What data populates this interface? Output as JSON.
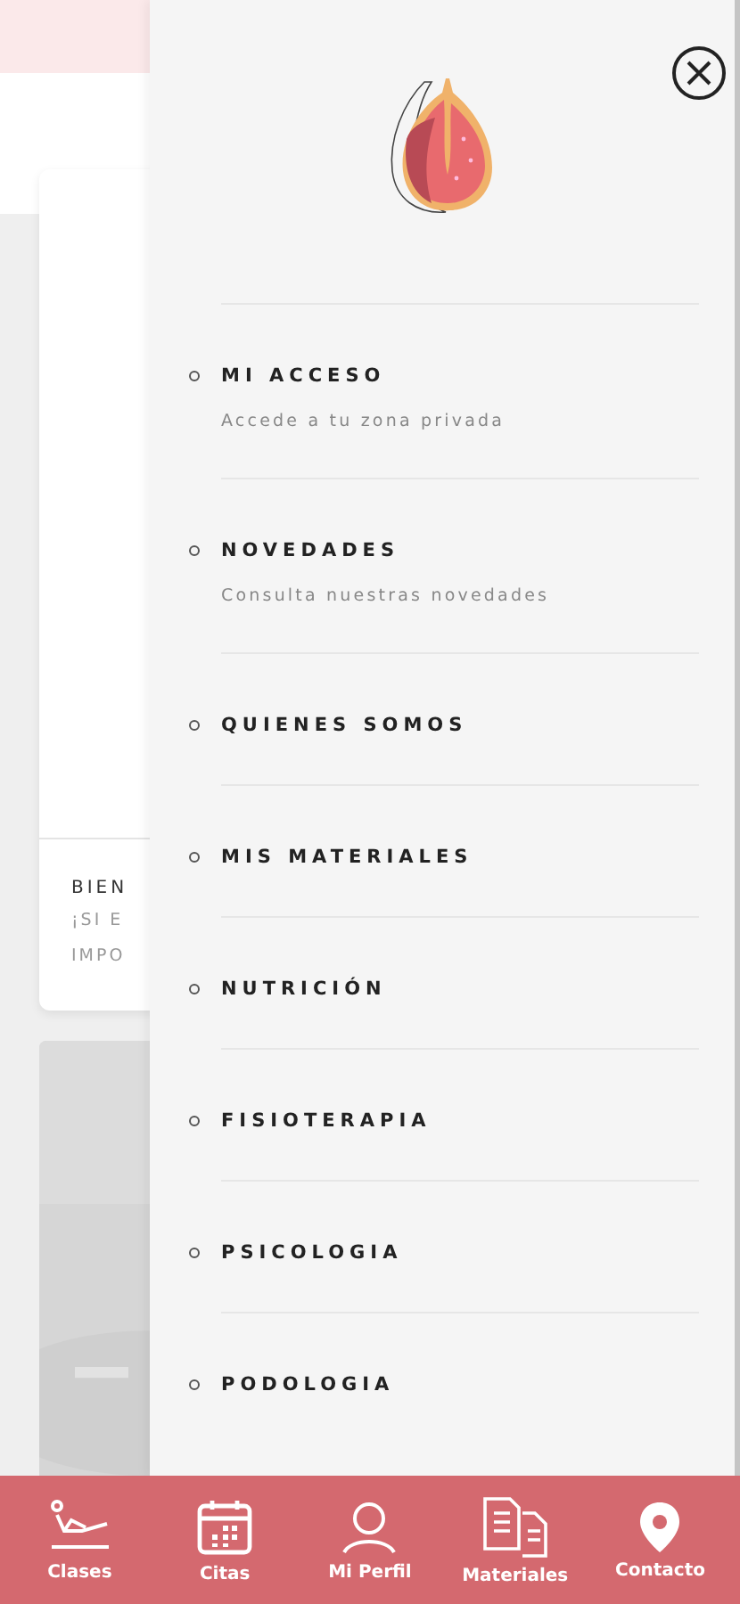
{
  "background_card": {
    "title": "BIEN",
    "text_lines": [
      "¡SI E",
      "IMPO"
    ]
  },
  "menu": {
    "items": [
      {
        "label": "MI ACCESO",
        "subtitle": "Accede a tu zona privada"
      },
      {
        "label": "NOVEDADES",
        "subtitle": "Consulta nuestras novedades"
      },
      {
        "label": "QUIENES SOMOS"
      },
      {
        "label": "MIS MATERIALES"
      },
      {
        "label": "NUTRICIÓN"
      },
      {
        "label": "FISIOTERAPIA"
      },
      {
        "label": "PSICOLOGIA"
      },
      {
        "label": "PODOLOGIA"
      }
    ]
  },
  "bottom_nav": [
    {
      "kind": "clases",
      "label": "Clases"
    },
    {
      "kind": "citas",
      "label": "Citas"
    },
    {
      "kind": "perfil",
      "label": "Mi Perfil"
    },
    {
      "kind": "materiales",
      "label": "Materiales"
    },
    {
      "kind": "contacto",
      "label": "Contacto"
    }
  ]
}
